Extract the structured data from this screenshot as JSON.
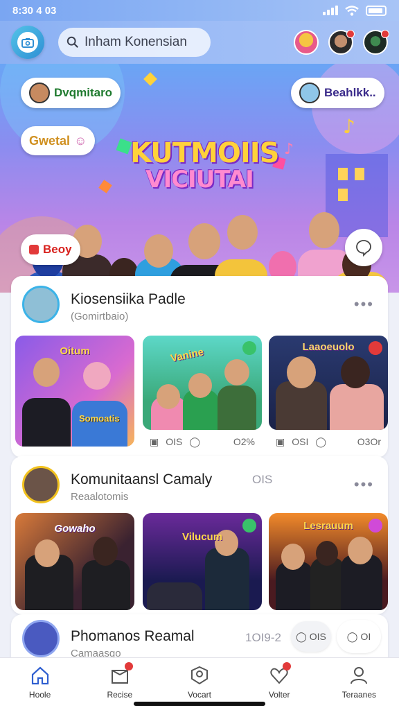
{
  "status_bar": {
    "time": "8:30 4 03"
  },
  "header": {
    "search_placeholder": "Inham Konensian"
  },
  "hero": {
    "title_line1": "KUTMOIIS",
    "title_line2": "VICIUTAI",
    "bubbles": [
      "Dvqmitaro",
      "Beahlkk..",
      "Gwetal",
      "Beoy"
    ]
  },
  "feed": {
    "cards": [
      {
        "title": "Kiosensiika Padle",
        "subtitle": "(Gomirtbaio)",
        "thumbs": [
          {
            "label": "Oitum",
            "overlay": "Somoatis",
            "stats": []
          },
          {
            "label": "Vanine",
            "stats": [
              "OIS",
              "",
              "O2%"
            ]
          },
          {
            "label": "Laaoeuolo",
            "stats": [
              "OSI",
              "",
              "O3Or"
            ]
          }
        ]
      },
      {
        "title": "Komunitaansl Camaly",
        "subtitle": "Reaalotomis",
        "side_stat": "OIS",
        "thumbs": [
          {
            "label": "Gowaho"
          },
          {
            "label": "Vilucum"
          },
          {
            "label": "Lesrauum"
          }
        ]
      },
      {
        "title": "Phomanos Reamal",
        "subtitle": "Camaasgo",
        "side_stat": "1OI9-2",
        "pill_left": "OIS",
        "pill_right": "OI"
      }
    ]
  },
  "bottom_nav": {
    "items": [
      "Hoole",
      "Recise",
      "Vocart",
      "Volter",
      "Teraanes"
    ]
  },
  "colors": {
    "accent_blue": "#2f8fd4",
    "badge_red": "#e23a3a",
    "hero_title_yellow": "#ffd23a"
  }
}
